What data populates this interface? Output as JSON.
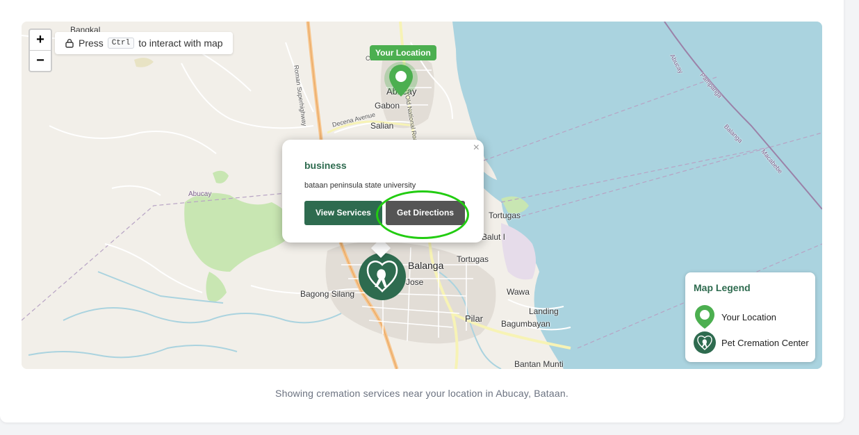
{
  "map": {
    "zoom_in": "+",
    "zoom_out": "−",
    "hint_prefix": "Press",
    "hint_key": "Ctrl",
    "hint_suffix": "to interact with map",
    "your_location_tag": "Your Location",
    "labels": {
      "bangkal": "Bangkal",
      "abucay": "Abucay",
      "gabon": "Gabon",
      "salian": "Salian",
      "catr": "Catr",
      "roman_highway": "Roman Superhighway",
      "old_national_road": "Old National Road",
      "decena_avenue": "Decena Avenue",
      "abucay_boundary": "Abucay",
      "tortugas1": "Tortugas",
      "balut": "Balut I",
      "tortugas2": "Tortugas",
      "balanga": "Balanga",
      "jose": "Jose",
      "bagong_silang": "Bagong Silang",
      "wawa": "Wawa",
      "landing": "Landing",
      "pilar": "Pilar",
      "bagumbayan": "Bagumbayan",
      "bantan_munti": "Bantan Munti",
      "sea_abucay": "Abucay",
      "sea_pampanga": "Pampanga",
      "sea_balanga": "Balanga",
      "sea_macabebe": "Macabebe"
    }
  },
  "popup": {
    "close": "×",
    "title": "business",
    "description": "bataan peninsula state university",
    "view_services": "View Services",
    "get_directions": "Get Directions"
  },
  "legend": {
    "title": "Map Legend",
    "your_location": "Your Location",
    "pet_cremation": "Pet Cremation Center"
  },
  "caption": "Showing cremation services near your location in Abucay, Bataan.",
  "colors": {
    "brand_green": "#2e6b4f",
    "location_green": "#4caf50",
    "highlight": "#22cc11",
    "water": "#aad3df"
  }
}
